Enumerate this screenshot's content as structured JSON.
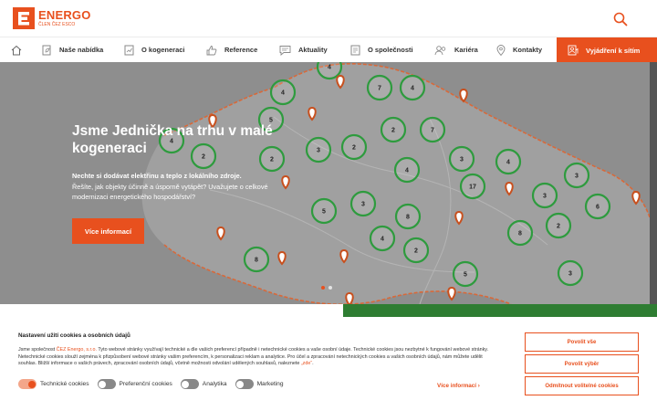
{
  "brand": {
    "name": "ENERGO",
    "tagline": "ČLEN ČEZ ESCO",
    "accent": "#e8501e"
  },
  "nav": {
    "items": [
      {
        "label": "Naše nabídka",
        "icon": "leaf-doc-icon"
      },
      {
        "label": "O kogeneraci",
        "icon": "chart-doc-icon"
      },
      {
        "label": "Reference",
        "icon": "thumbs-up-icon"
      },
      {
        "label": "Aktuality",
        "icon": "chat-icon"
      },
      {
        "label": "O společnosti",
        "icon": "document-icon"
      },
      {
        "label": "Kariéra",
        "icon": "people-icon"
      },
      {
        "label": "Kontakty",
        "icon": "location-pin-icon"
      }
    ],
    "cta": "Vyjádření k sítím"
  },
  "hero": {
    "title": "Jsme Jednička na trhu v malé kogeneraci",
    "lead": "Nechte si dodávat elektřinu a teplo z lokálního zdroje.",
    "body": "Řešíte, jak objekty účinně a úsporně vytápět? Uvažujete o celkové modernizaci energetického hospodářství?",
    "button": "Více informací",
    "map_clusters": [
      "4",
      "4",
      "7",
      "4",
      "5",
      "4",
      "2",
      "2",
      "7",
      "2",
      "3",
      "2",
      "3",
      "4",
      "4",
      "17",
      "3",
      "6",
      "3",
      "8",
      "5",
      "3",
      "8",
      "4",
      "2",
      "2",
      "8",
      "5",
      "3"
    ]
  },
  "cookies": {
    "title": "Nastavení užití cookies a osobních údajů",
    "text_pre": "Jsme společnost ",
    "text_link": "ČEZ Energo, s.r.o.",
    "text_post": " Tyto webové stránky využívají technické a dle vašich preferencí případně i netechnické cookies a vaše osobní údaje. Technické cookies jsou nezbytné k fungování webové stránky. Netechnické cookies slouží zejména k přizpůsobení webové stránky vašim preferencím, k personalizaci reklam a analytice. Pro účel a zpracování netechnických cookies a vašich osobních údajů, nám můžete udělit souhlas. Bližší informace o vašich právech, zpracování osobních údajů, včetně možnosti odvolání udělených souhlasů, naleznete ",
    "text_here": "„zde“",
    "text_end": ".",
    "toggles": [
      {
        "label": "Technické cookies",
        "on": true
      },
      {
        "label": "Preferenční cookies",
        "on": false
      },
      {
        "label": "Analytika",
        "on": false
      },
      {
        "label": "Marketing",
        "on": false
      }
    ],
    "more": "Více informací",
    "buttons": {
      "allow": "Povolit vše",
      "choose": "Povolit výběr",
      "reject": "Odmítnout volitelné cookies"
    }
  }
}
